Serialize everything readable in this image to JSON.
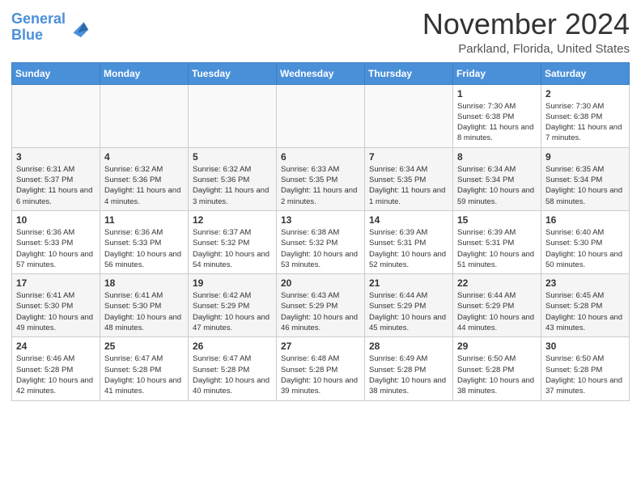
{
  "header": {
    "logo_line1": "General",
    "logo_line2": "Blue",
    "month": "November 2024",
    "location": "Parkland, Florida, United States"
  },
  "days_of_week": [
    "Sunday",
    "Monday",
    "Tuesday",
    "Wednesday",
    "Thursday",
    "Friday",
    "Saturday"
  ],
  "weeks": [
    [
      {
        "num": "",
        "info": ""
      },
      {
        "num": "",
        "info": ""
      },
      {
        "num": "",
        "info": ""
      },
      {
        "num": "",
        "info": ""
      },
      {
        "num": "",
        "info": ""
      },
      {
        "num": "1",
        "info": "Sunrise: 7:30 AM\nSunset: 6:38 PM\nDaylight: 11 hours\nand 8 minutes."
      },
      {
        "num": "2",
        "info": "Sunrise: 7:30 AM\nSunset: 6:38 PM\nDaylight: 11 hours\nand 7 minutes."
      }
    ],
    [
      {
        "num": "3",
        "info": "Sunrise: 6:31 AM\nSunset: 5:37 PM\nDaylight: 11 hours\nand 6 minutes."
      },
      {
        "num": "4",
        "info": "Sunrise: 6:32 AM\nSunset: 5:36 PM\nDaylight: 11 hours\nand 4 minutes."
      },
      {
        "num": "5",
        "info": "Sunrise: 6:32 AM\nSunset: 5:36 PM\nDaylight: 11 hours\nand 3 minutes."
      },
      {
        "num": "6",
        "info": "Sunrise: 6:33 AM\nSunset: 5:35 PM\nDaylight: 11 hours\nand 2 minutes."
      },
      {
        "num": "7",
        "info": "Sunrise: 6:34 AM\nSunset: 5:35 PM\nDaylight: 11 hours\nand 1 minute."
      },
      {
        "num": "8",
        "info": "Sunrise: 6:34 AM\nSunset: 5:34 PM\nDaylight: 10 hours\nand 59 minutes."
      },
      {
        "num": "9",
        "info": "Sunrise: 6:35 AM\nSunset: 5:34 PM\nDaylight: 10 hours\nand 58 minutes."
      }
    ],
    [
      {
        "num": "10",
        "info": "Sunrise: 6:36 AM\nSunset: 5:33 PM\nDaylight: 10 hours\nand 57 minutes."
      },
      {
        "num": "11",
        "info": "Sunrise: 6:36 AM\nSunset: 5:33 PM\nDaylight: 10 hours\nand 56 minutes."
      },
      {
        "num": "12",
        "info": "Sunrise: 6:37 AM\nSunset: 5:32 PM\nDaylight: 10 hours\nand 54 minutes."
      },
      {
        "num": "13",
        "info": "Sunrise: 6:38 AM\nSunset: 5:32 PM\nDaylight: 10 hours\nand 53 minutes."
      },
      {
        "num": "14",
        "info": "Sunrise: 6:39 AM\nSunset: 5:31 PM\nDaylight: 10 hours\nand 52 minutes."
      },
      {
        "num": "15",
        "info": "Sunrise: 6:39 AM\nSunset: 5:31 PM\nDaylight: 10 hours\nand 51 minutes."
      },
      {
        "num": "16",
        "info": "Sunrise: 6:40 AM\nSunset: 5:30 PM\nDaylight: 10 hours\nand 50 minutes."
      }
    ],
    [
      {
        "num": "17",
        "info": "Sunrise: 6:41 AM\nSunset: 5:30 PM\nDaylight: 10 hours\nand 49 minutes."
      },
      {
        "num": "18",
        "info": "Sunrise: 6:41 AM\nSunset: 5:30 PM\nDaylight: 10 hours\nand 48 minutes."
      },
      {
        "num": "19",
        "info": "Sunrise: 6:42 AM\nSunset: 5:29 PM\nDaylight: 10 hours\nand 47 minutes."
      },
      {
        "num": "20",
        "info": "Sunrise: 6:43 AM\nSunset: 5:29 PM\nDaylight: 10 hours\nand 46 minutes."
      },
      {
        "num": "21",
        "info": "Sunrise: 6:44 AM\nSunset: 5:29 PM\nDaylight: 10 hours\nand 45 minutes."
      },
      {
        "num": "22",
        "info": "Sunrise: 6:44 AM\nSunset: 5:29 PM\nDaylight: 10 hours\nand 44 minutes."
      },
      {
        "num": "23",
        "info": "Sunrise: 6:45 AM\nSunset: 5:28 PM\nDaylight: 10 hours\nand 43 minutes."
      }
    ],
    [
      {
        "num": "24",
        "info": "Sunrise: 6:46 AM\nSunset: 5:28 PM\nDaylight: 10 hours\nand 42 minutes."
      },
      {
        "num": "25",
        "info": "Sunrise: 6:47 AM\nSunset: 5:28 PM\nDaylight: 10 hours\nand 41 minutes."
      },
      {
        "num": "26",
        "info": "Sunrise: 6:47 AM\nSunset: 5:28 PM\nDaylight: 10 hours\nand 40 minutes."
      },
      {
        "num": "27",
        "info": "Sunrise: 6:48 AM\nSunset: 5:28 PM\nDaylight: 10 hours\nand 39 minutes."
      },
      {
        "num": "28",
        "info": "Sunrise: 6:49 AM\nSunset: 5:28 PM\nDaylight: 10 hours\nand 38 minutes."
      },
      {
        "num": "29",
        "info": "Sunrise: 6:50 AM\nSunset: 5:28 PM\nDaylight: 10 hours\nand 38 minutes."
      },
      {
        "num": "30",
        "info": "Sunrise: 6:50 AM\nSunset: 5:28 PM\nDaylight: 10 hours\nand 37 minutes."
      }
    ]
  ]
}
